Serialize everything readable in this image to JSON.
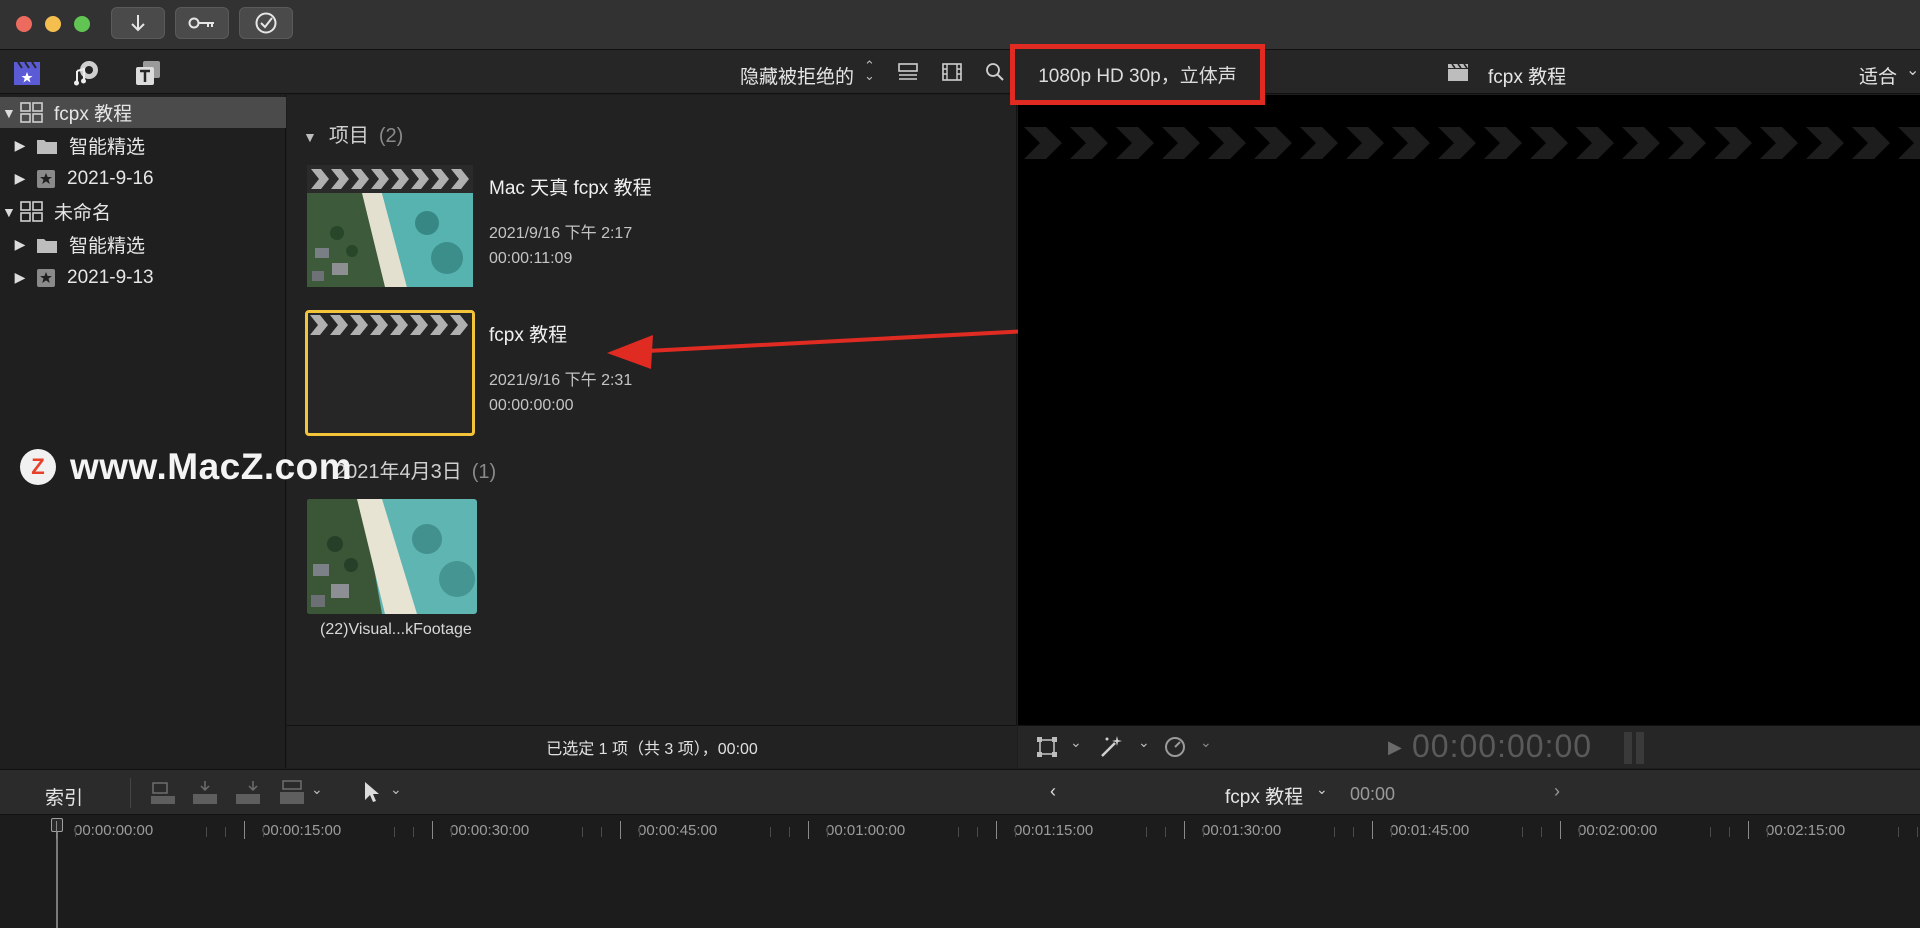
{
  "toolbar": {
    "filter_label": "隐藏被拒绝的",
    "format_label": "1080p HD 30p，立体声",
    "viewer_title": "fcpx 教程",
    "fit_label": "适合"
  },
  "sidebar": {
    "items": [
      {
        "label": "fcpx 教程",
        "icon": "library-grid-icon",
        "level": 0,
        "expanded": true,
        "selected": true
      },
      {
        "label": "智能精选",
        "icon": "folder-icon",
        "level": 1,
        "expanded": false
      },
      {
        "label": "2021-9-16",
        "icon": "star-event-icon",
        "level": 1,
        "expanded": false
      },
      {
        "label": "未命名",
        "icon": "library-grid-icon",
        "level": 0,
        "expanded": true
      },
      {
        "label": "智能精选",
        "icon": "folder-icon",
        "level": 1,
        "expanded": false
      },
      {
        "label": "2021-9-13",
        "icon": "star-event-icon",
        "level": 1,
        "expanded": false
      }
    ]
  },
  "browser": {
    "projects_header": "项目",
    "projects_count": "(2)",
    "projects": [
      {
        "title": "Mac 天真 fcpx 教程",
        "date": "2021/9/16 下午 2:17",
        "duration": "00:00:11:09"
      },
      {
        "title": "fcpx 教程",
        "date": "2021/9/16 下午 2:31",
        "duration": "00:00:00:00",
        "selected": true
      }
    ],
    "date_header": "2021年4月3日",
    "date_count": "(1)",
    "clip_label": "(22)Visual...kFootage",
    "status": "已选定 1 项（共 3 项），00:00"
  },
  "viewer": {
    "timecode": "00:00:00:00"
  },
  "timeline": {
    "index_label": "索引",
    "title": "fcpx 教程",
    "time": "00:00",
    "ruler_labels": [
      "00:00:00:00",
      "00:00:15:00",
      "00:00:30:00",
      "00:00:45:00",
      "00:01:00:00",
      "00:01:15:00",
      "00:01:30:00",
      "00:01:45:00",
      "00:02:00:00",
      "00:02:15:00"
    ]
  },
  "watermark": {
    "logo_letter": "Z",
    "text": "www.MacZ.com"
  },
  "colors": {
    "highlight_box": "#e02b22",
    "selection_border": "#f3c33a",
    "arrow": "#e02b22",
    "library_icon_active": "#5b5bd6"
  }
}
